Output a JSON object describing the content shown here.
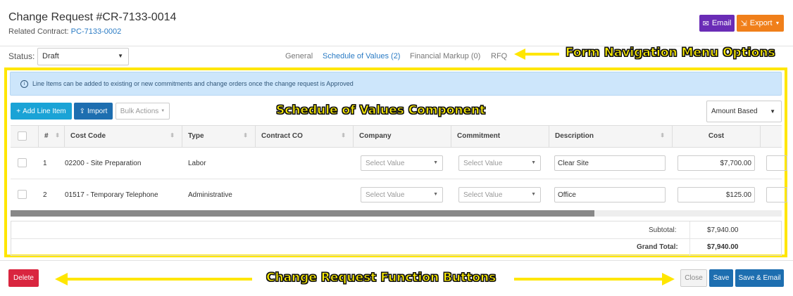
{
  "header": {
    "title": "Change Request #CR-7133-0014",
    "related_label": "Related Contract:",
    "related_link": "PC-7133-0002",
    "email_label": "Email",
    "export_label": "Export"
  },
  "status": {
    "label": "Status:",
    "value": "Draft"
  },
  "nav": {
    "items": [
      "General",
      "Schedule of Values (2)",
      "Financial Markup (0)",
      "RFQ"
    ],
    "active": "Schedule of Values (2)"
  },
  "annotations": {
    "nav_options": "Form Navigation Menu Options",
    "sov_component": "Schedule of Values Component",
    "function_buttons": "Change Request Function Buttons"
  },
  "info_text": "Line Items can be added to existing or new commitments and change orders once the change request is Approved",
  "toolbar": {
    "add_line": "Add Line Item",
    "import": "Import",
    "bulk_actions": "Bulk Actions",
    "amount_mode": "Amount Based"
  },
  "table": {
    "columns": [
      "#",
      "Cost Code",
      "Type",
      "Contract CO",
      "Company",
      "Commitment",
      "Description",
      "Cost"
    ],
    "rows": [
      {
        "num": "1",
        "cost_code": "02200 - Site Preparation",
        "type": "Labor",
        "company": "Select Value",
        "commitment": "Select Value",
        "description": "Clear Site",
        "cost": "$7,700.00"
      },
      {
        "num": "2",
        "cost_code": "01517 - Temporary Telephone",
        "type": "Administrative",
        "company": "Select Value",
        "commitment": "Select Value",
        "description": "Office",
        "cost": "$125.00"
      }
    ]
  },
  "totals": {
    "subtotal_label": "Subtotal:",
    "subtotal_value": "$7,940.00",
    "grand_total_label": "Grand Total:",
    "grand_total_value": "$7,940.00"
  },
  "footer": {
    "delete": "Delete",
    "close": "Close",
    "save": "Save",
    "save_email": "Save & Email"
  },
  "colors": {
    "annotation_yellow": "#ffe600",
    "link_blue": "#2a7bc4",
    "email_purple": "#6a2cb6",
    "export_orange": "#f07f1a",
    "delete_red": "#d9253f",
    "save_blue": "#1d6eb0"
  }
}
